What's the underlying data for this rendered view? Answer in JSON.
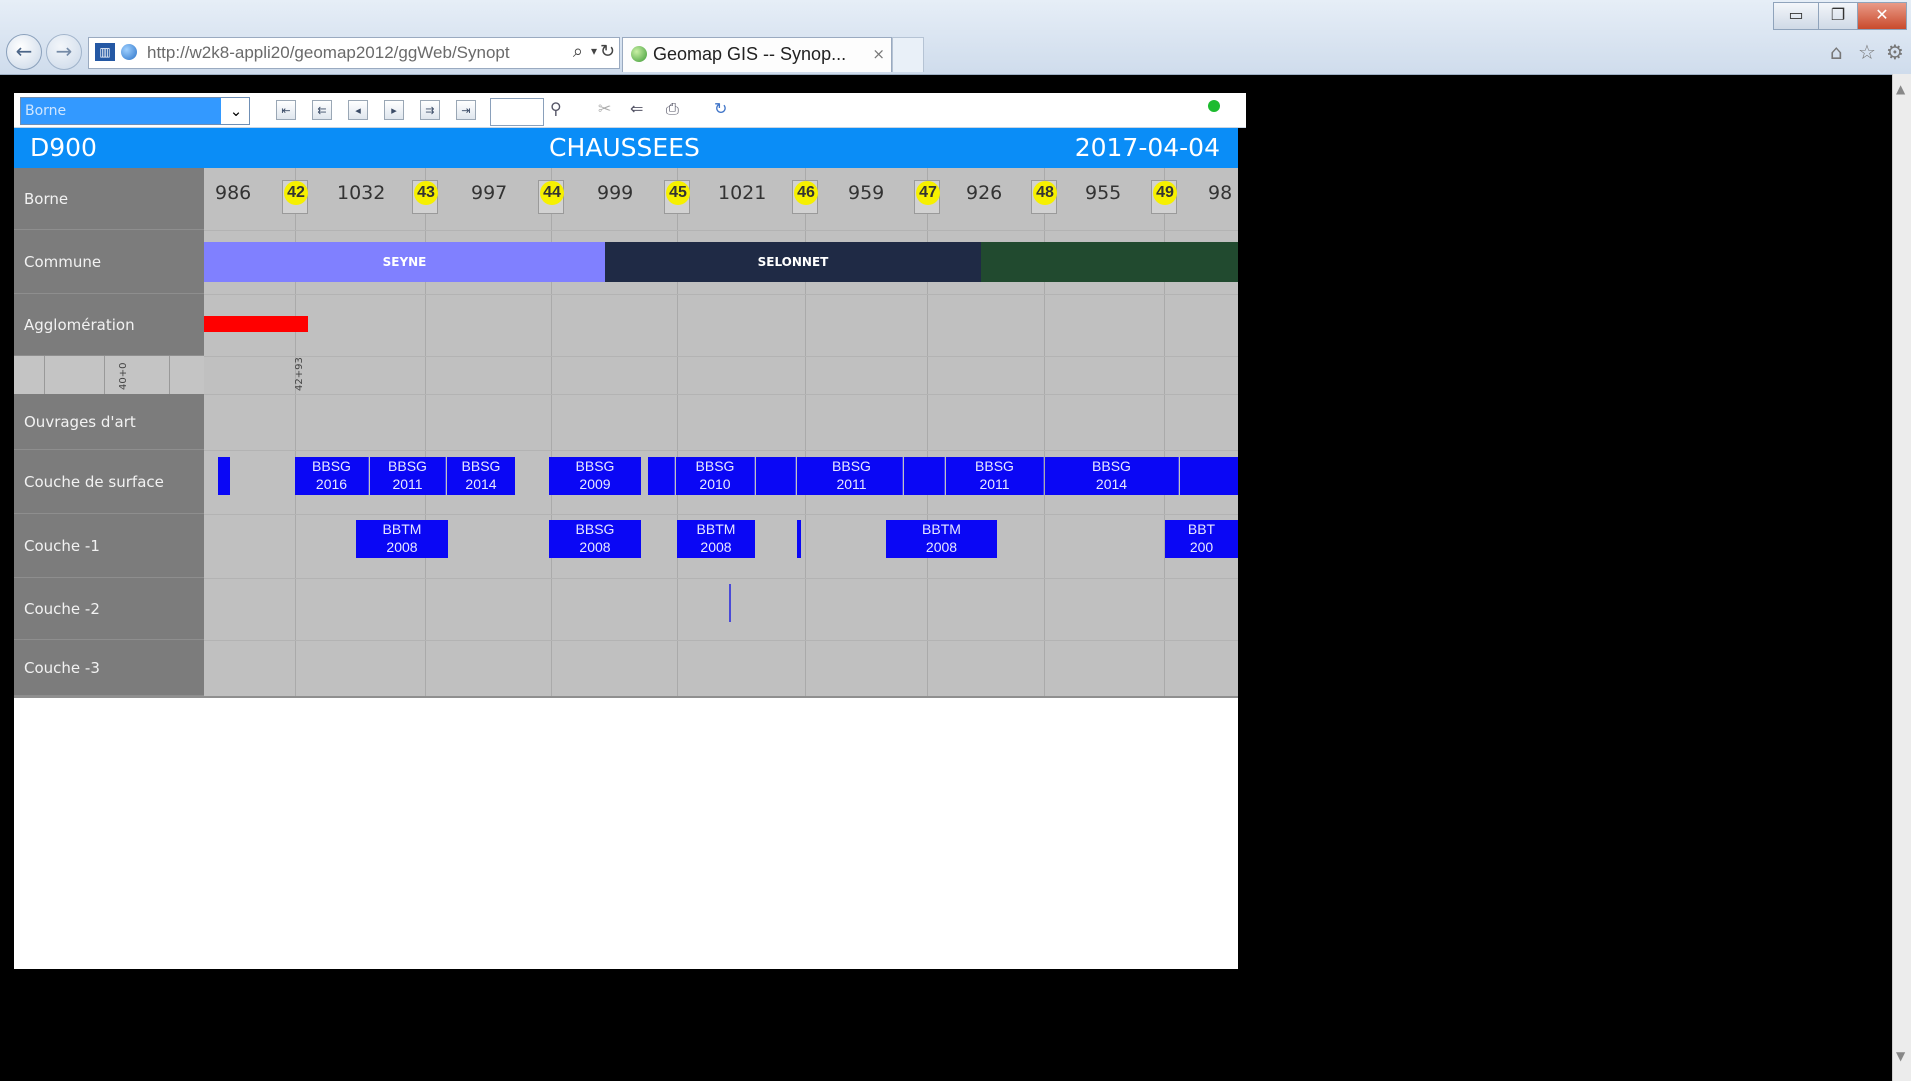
{
  "browser": {
    "url": "http://w2k8-appli20/geomap2012/ggWeb/Synopt",
    "tab_title": "Geomap GIS -- Synop...",
    "tab_close": "×",
    "back_glyph": "←",
    "forward_glyph": "→",
    "search_glyph": "⌕",
    "dropdown_glyph": "▾",
    "refresh_glyph": "↻",
    "minimize_glyph": "▭",
    "restore_glyph": "❐",
    "close_glyph": "✕",
    "home_glyph": "⌂",
    "favorites_glyph": "☆",
    "tools_glyph": "⚙"
  },
  "toolbar": {
    "selector_value": "Borne",
    "selector_arrow": "⌄",
    "nav_buttons": [
      "⇤",
      "⇇",
      "◂",
      "▸",
      "⇉",
      "⇥"
    ],
    "page_value": "",
    "zoom_glyph": "⚲",
    "tool_glyphs": [
      "✂",
      "⇐",
      "⎙",
      "↻"
    ],
    "status_color": "#1dbb2f"
  },
  "header": {
    "road": "D900",
    "category": "CHAUSSEES",
    "date": "2017-04-04"
  },
  "rows": {
    "borne": "Borne",
    "commune": "Commune",
    "agglomeration": "Agglomération",
    "ouvrages": "Ouvrages d'art",
    "surface": "Couche de surface",
    "couche1": "Couche -1",
    "couche2": "Couche -2",
    "couche3": "Couche -3"
  },
  "pr_distances": [
    "986",
    "1032",
    "997",
    "999",
    "1021",
    "959",
    "926",
    "955",
    "98"
  ],
  "markers": [
    "42",
    "43",
    "44",
    "45",
    "46",
    "47",
    "48",
    "49"
  ],
  "communes": [
    {
      "name": "SEYNE",
      "color": "#8080ff"
    },
    {
      "name": "SELONNET",
      "color": "#1f2a45"
    },
    {
      "name": "",
      "color": "#214a2f"
    }
  ],
  "agglomeration_color": "#ff0000",
  "offset_ticks": [
    "40+0",
    "42+93"
  ],
  "surface_blocks": [
    {
      "text": ""
    },
    {
      "text": "BBSG\n2016"
    },
    {
      "text": "BBSG\n2011"
    },
    {
      "text": "BBSG\n2014"
    },
    {
      "text": "BBSG\n2009"
    },
    {
      "text": ""
    },
    {
      "text": "BBSG\n2010"
    },
    {
      "text": ""
    },
    {
      "text": ""
    },
    {
      "text": "BBSG\n2011"
    },
    {
      "text": ""
    },
    {
      "text": "BBSG\n2011"
    },
    {
      "text": "BBSG\n2014"
    },
    {
      "text": ""
    }
  ],
  "couche1_blocks": [
    {
      "text": "BBTM\n2008"
    },
    {
      "text": "BBSG\n2008"
    },
    {
      "text": "BBTM\n2008"
    },
    {
      "text": ""
    },
    {
      "text": "BBTM\n2008"
    },
    {
      "text": "BBT\n200"
    }
  ],
  "block_color": "#0a07f5"
}
